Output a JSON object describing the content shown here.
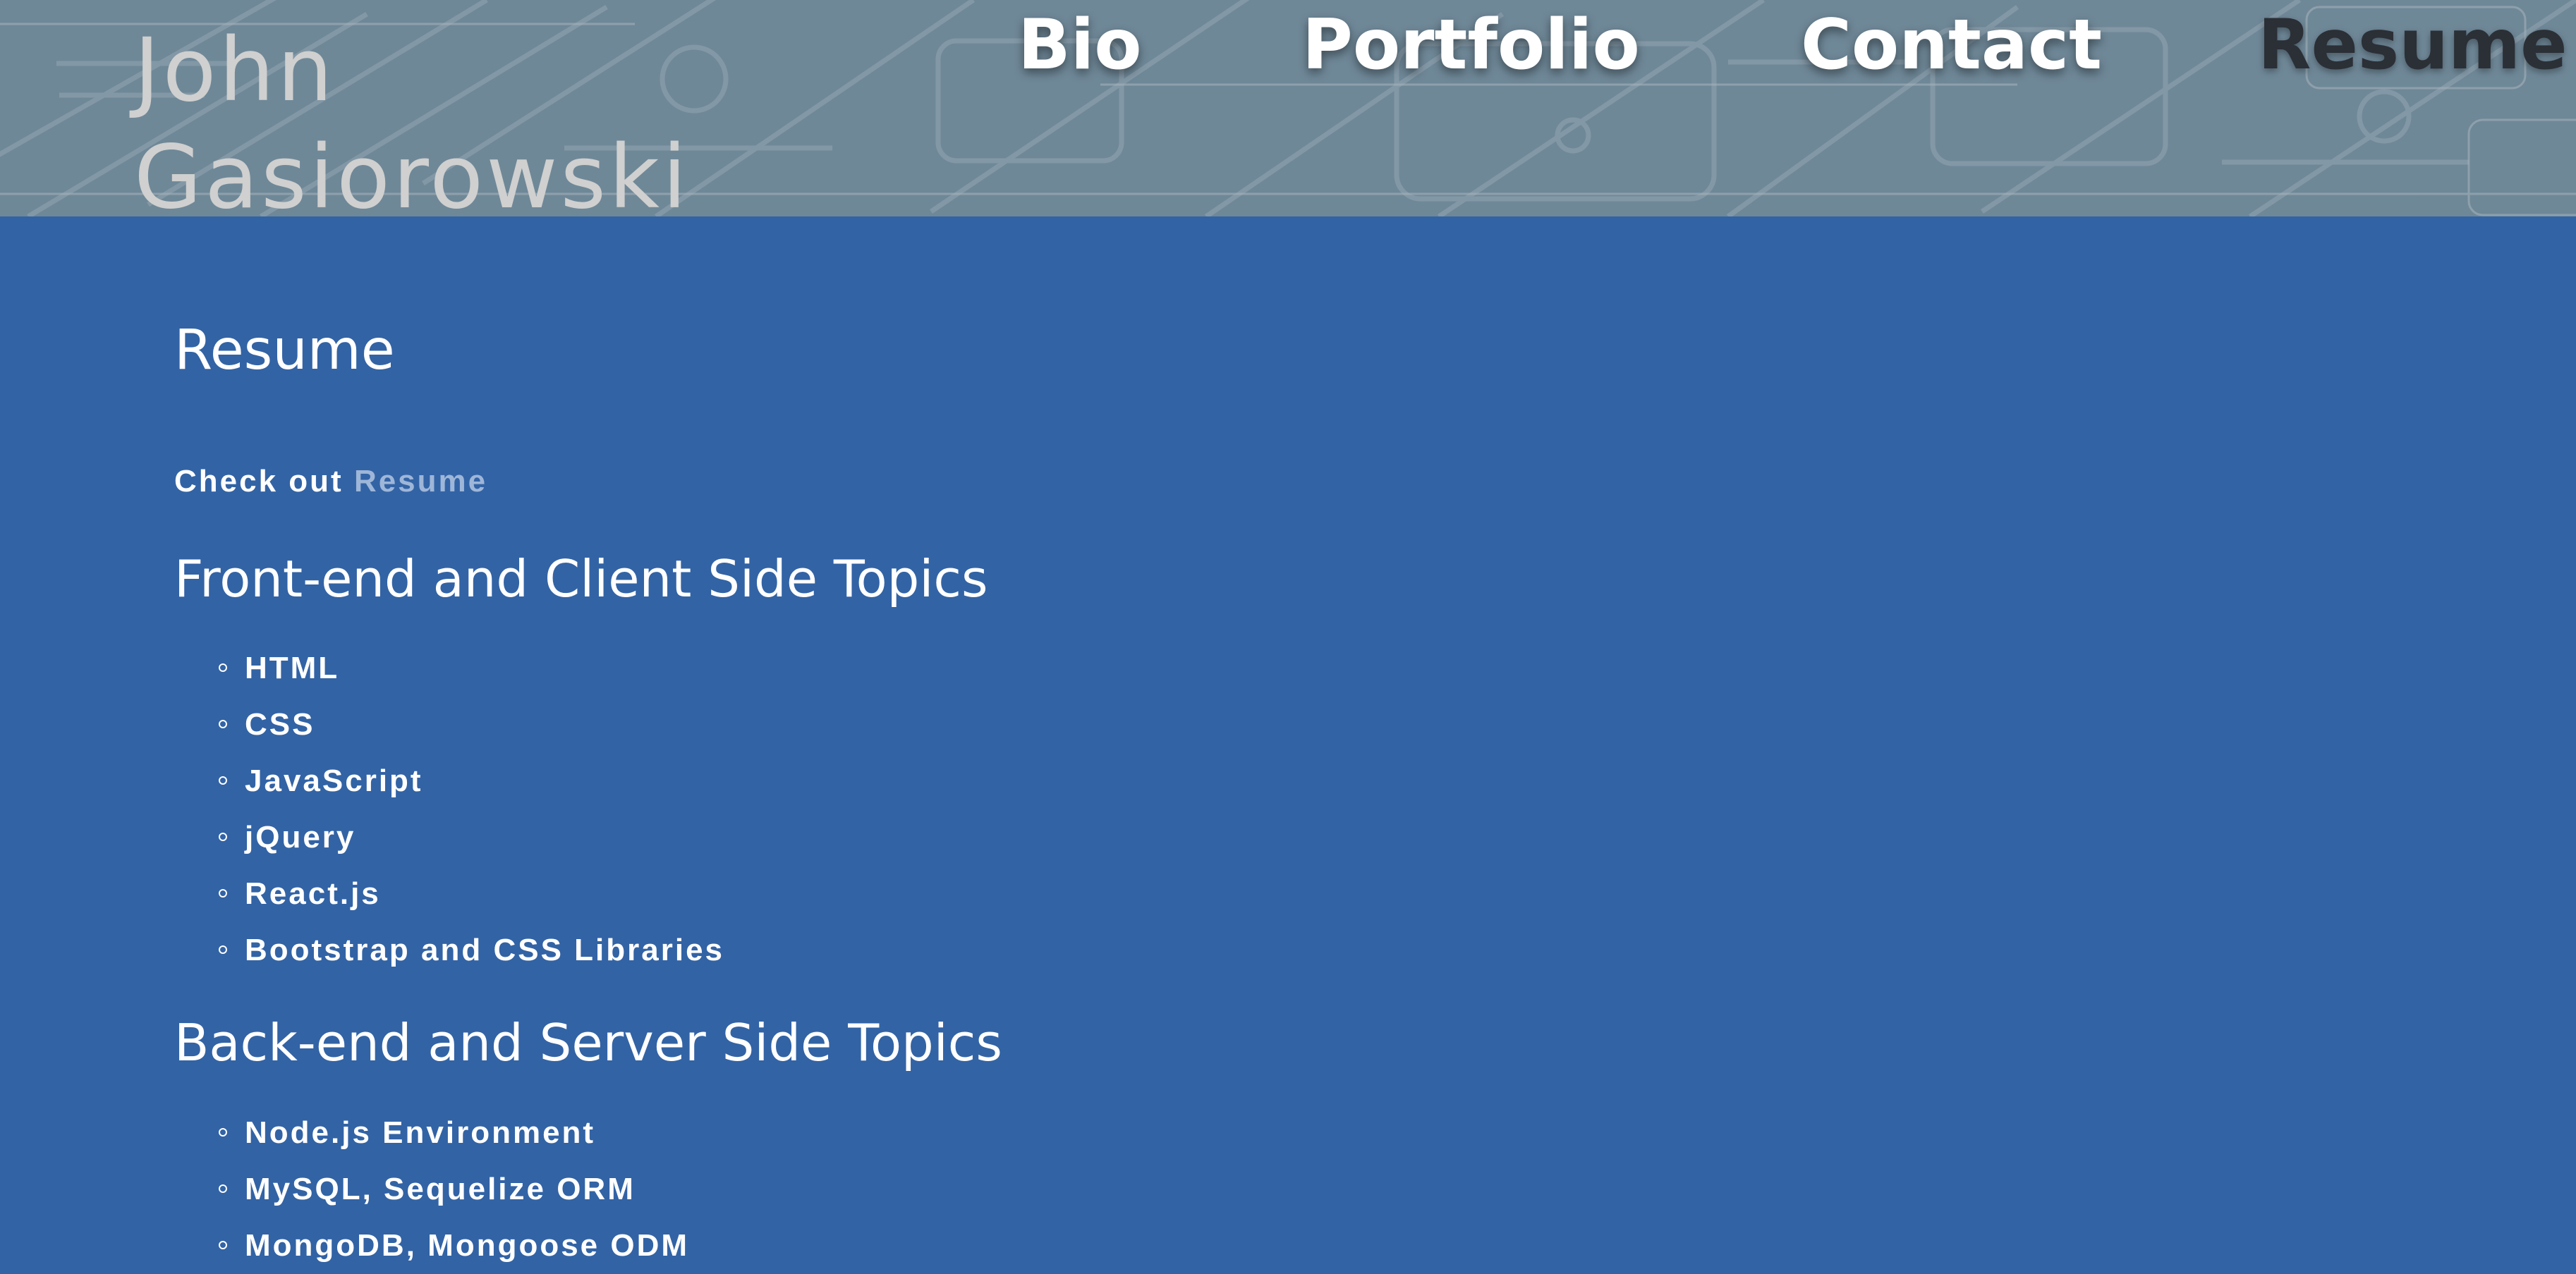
{
  "header": {
    "site_name": "John Gasiorowski",
    "nav": [
      {
        "label": "Bio",
        "active": false
      },
      {
        "label": "Portfolio",
        "active": false
      },
      {
        "label": "Contact",
        "active": false
      },
      {
        "label": "Resume",
        "active": true
      }
    ]
  },
  "main": {
    "title": "Resume",
    "intro_prefix": "Check out",
    "intro_link": "Resume",
    "sections": [
      {
        "heading": "Front-end and Client Side Topics",
        "items": [
          "HTML",
          "CSS",
          "JavaScript",
          "jQuery",
          "React.js",
          "Bootstrap and CSS Libraries"
        ]
      },
      {
        "heading": "Back-end and Server Side Topics",
        "items": [
          "Node.js Environment",
          "MySQL, Sequelize ORM",
          "MongoDB, Mongoose ODM"
        ]
      }
    ]
  },
  "colors": {
    "page_background": "#3263a5",
    "header_background": "#6e8797",
    "active_nav": "#2b2f36",
    "link": "#9eb6d8"
  }
}
